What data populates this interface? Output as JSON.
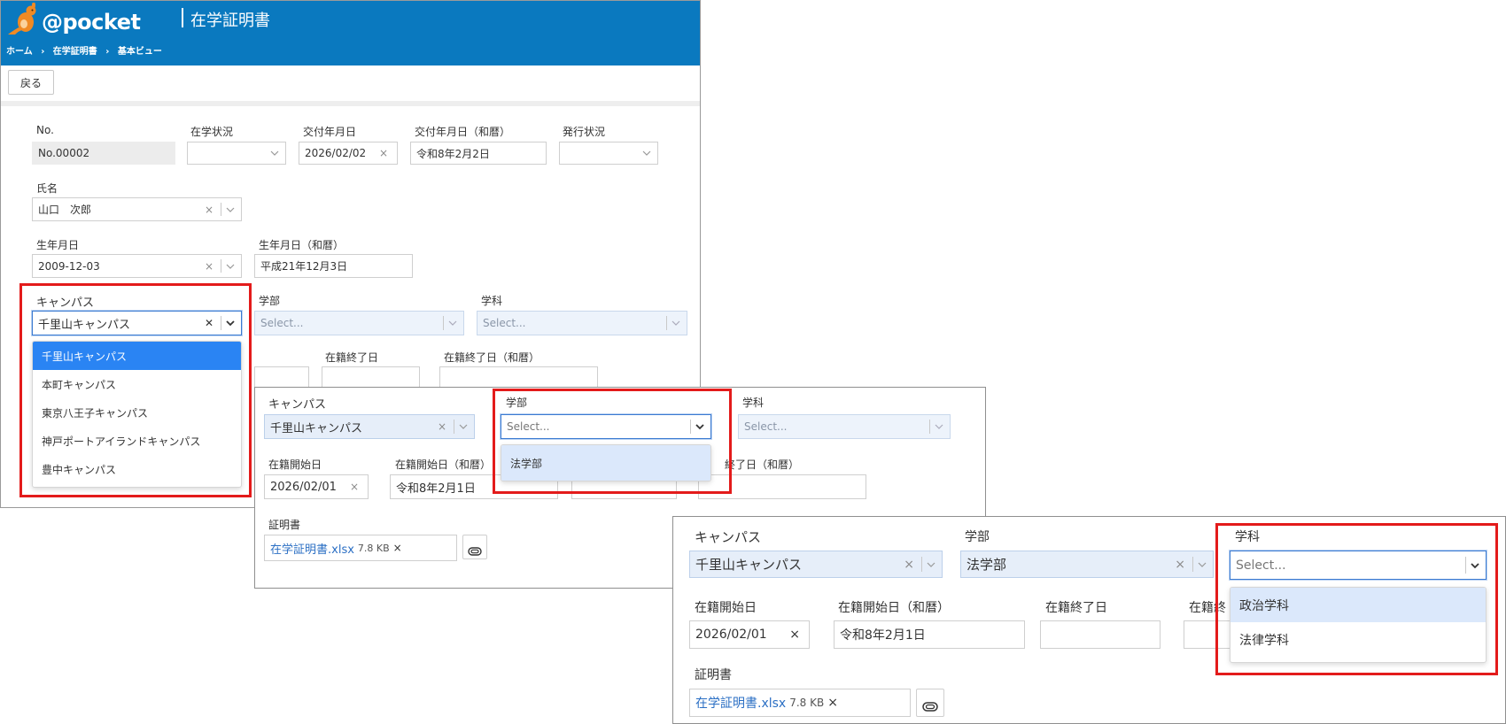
{
  "header": {
    "logo_text": "@pocket",
    "title": "在学証明書",
    "breadcrumb": [
      "ホーム",
      "在学証明書",
      "基本ビュー"
    ],
    "bg_color": "#0a79bf"
  },
  "toolbar": {
    "back_label": "戻る"
  },
  "main": {
    "labels": {
      "no": "No.",
      "status": "在学状況",
      "issue_date": "交付年月日",
      "issue_date_jp": "交付年月日（和暦）",
      "issue_status": "発行状況",
      "name": "氏名",
      "birth": "生年月日",
      "birth_jp": "生年月日（和暦）",
      "campus": "キャンパス",
      "faculty": "学部",
      "department": "学科",
      "enroll_end": "在籍終了日",
      "enroll_end_jp": "在籍終了日（和暦）"
    },
    "values": {
      "no": "No.00002",
      "issue_date": "2026/02/02",
      "issue_date_jp": "令和8年2月2日",
      "name": "山口　次郎",
      "birth": "2009-12-03",
      "birth_jp": "平成21年12月3日",
      "campus": "千里山キャンパス",
      "select_placeholder": "Select..."
    },
    "campus_options": [
      "千里山キャンパス",
      "本町キャンパス",
      "東京八王子キャンパス",
      "神戸ポートアイランドキャンパス",
      "豊中キャンパス"
    ]
  },
  "panel2": {
    "labels": {
      "campus": "キャンパス",
      "faculty": "学部",
      "department": "学科",
      "enroll_start": "在籍開始日",
      "enroll_start_jp": "在籍開始日（和暦）",
      "enroll_end_jp_partial": "終了日（和暦）",
      "cert": "証明書"
    },
    "values": {
      "campus": "千里山キャンパス",
      "faculty_placeholder": "Select...",
      "department_placeholder": "Select...",
      "enroll_start": "2026/02/01",
      "enroll_start_jp": "令和8年2月1日",
      "file_name": "在学証明書.xlsx",
      "file_size": "7.8 KB"
    },
    "faculty_options": [
      "法学部"
    ]
  },
  "panel3": {
    "labels": {
      "campus": "キャンパス",
      "faculty": "学部",
      "department": "学科",
      "enroll_start": "在籍開始日",
      "enroll_start_jp": "在籍開始日（和暦）",
      "enroll_end": "在籍終了日",
      "enroll_end_partial": "在籍終",
      "cert": "証明書"
    },
    "values": {
      "campus": "千里山キャンパス",
      "faculty": "法学部",
      "department_placeholder": "Select...",
      "enroll_start": "2026/02/01",
      "enroll_start_jp": "令和8年2月1日",
      "file_name": "在学証明書.xlsx",
      "file_size": "7.8 KB"
    },
    "department_options": [
      "政治学科",
      "法律学科"
    ]
  },
  "icons": {
    "clear": "×",
    "clear_bold": "✕",
    "chevron": "chevron-down-icon",
    "attach": "paperclip-icon"
  },
  "colors": {
    "highlight": "#e31b1b",
    "accent": "#2a84f3",
    "link": "#2b6fc4"
  }
}
